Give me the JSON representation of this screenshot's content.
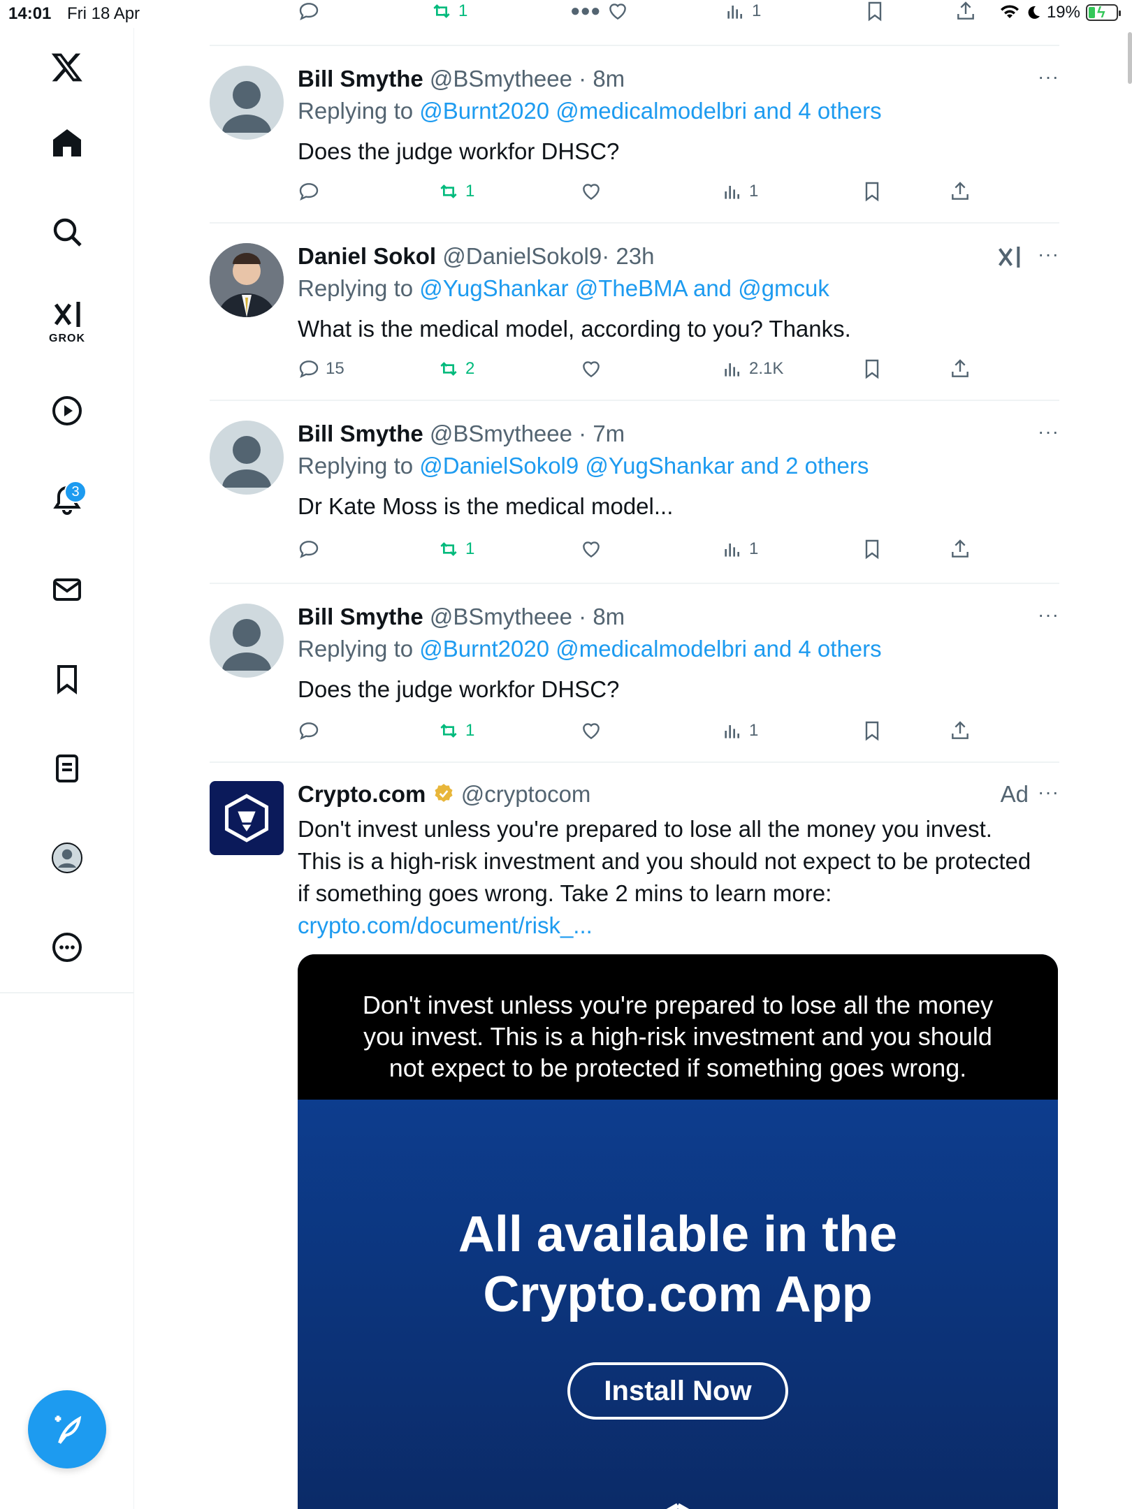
{
  "status_bar": {
    "time": "14:01",
    "date": "Fri 18 Apr",
    "battery": "19%"
  },
  "sidebar": {
    "grok_label": "GROK",
    "notifications_badge": "3"
  },
  "top_partial_actions": {
    "retweets": "1",
    "views": "1"
  },
  "tweets": [
    {
      "name": "Bill Smythe",
      "handle": "@BSmytheee",
      "time": "· 8m",
      "reply_prefix": "Replying to",
      "reply_links": "@Burnt2020 @medicalmodelbri and 4 others",
      "text": "Does the judge workfor DHSC?",
      "retweets": "1",
      "views": "1",
      "replies": "",
      "likes": ""
    },
    {
      "name": "Daniel Sokol",
      "handle": "@DanielSokol9",
      "time": "· 23h",
      "reply_prefix": "Replying to",
      "reply_links": "@YugShankar @TheBMA and @gmcuk",
      "text": "What is the medical model, according to you? Thanks.",
      "replies": "15",
      "retweets": "2",
      "views": "2.1K",
      "likes": ""
    },
    {
      "name": "Bill Smythe",
      "handle": "@BSmytheee",
      "time": "· 7m",
      "reply_prefix": "Replying to",
      "reply_links": "@DanielSokol9 @YugShankar and 2 others",
      "text": "Dr Kate Moss is the medical model...",
      "retweets": "1",
      "views": "1",
      "replies": "",
      "likes": ""
    },
    {
      "name": "Bill Smythe",
      "handle": "@BSmytheee",
      "time": "· 8m",
      "reply_prefix": "Replying to",
      "reply_links": "@Burnt2020 @medicalmodelbri and 4 others",
      "text": "Does the judge workfor DHSC?",
      "retweets": "1",
      "views": "1",
      "replies": "",
      "likes": ""
    }
  ],
  "ad": {
    "name": "Crypto.com",
    "handle": "@cryptocom",
    "label": "Ad",
    "body": "Don't invest unless you're prepared to lose all the money you invest. This is a high-risk investment and you should not expect to be protected if something goes wrong. Take 2 mins to learn more:",
    "link": "crypto.com/document/risk_...",
    "card_disclaimer": "Don't invest unless you're prepared to lose all the money you invest. This is a high-risk investment and you should not expect to be protected if something goes wrong.",
    "card_headline_1": "All available in the",
    "card_headline_2": "Crypto.com App",
    "card_cta": "Install Now"
  },
  "colors": {
    "accent": "#1d9bf0",
    "retweet": "#00ba7c",
    "muted": "#536471",
    "gold_badge": "#e8b63a"
  }
}
